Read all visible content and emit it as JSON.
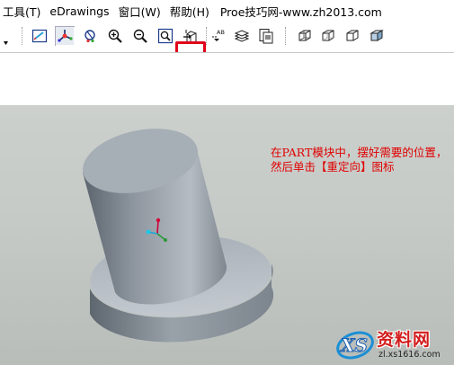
{
  "menu": [
    {
      "label": "工具(T)"
    },
    {
      "label": "eDrawings"
    },
    {
      "label": "窗口(W)"
    },
    {
      "label": "帮助(H)"
    }
  ],
  "site_label": "Proe技巧网-www.zh2013.com",
  "toolbar": {
    "icons": [
      "dropdown-arrow-icon",
      "repaint-icon",
      "spin-center-icon",
      "orient-mode-icon",
      "zoom-in-icon",
      "zoom-out-icon",
      "refit-icon",
      "reorient-icon",
      "annotation-display-icon",
      "layers-icon",
      "view-manager-icon",
      "wireframe-icon",
      "hidden-line-icon",
      "no-hidden-icon",
      "shading-icon"
    ],
    "highlighted": "reorient-icon",
    "annotation_text": "AB",
    "highlight_color": "#e0001a"
  },
  "annotation": {
    "text": "在PART模块中，摆好需要的位置，然后单击【重定向】图标",
    "color": "#e00000"
  },
  "watermark": {
    "title": "资料网",
    "url": "zl.xs1616.com",
    "logo_text": "XS"
  }
}
